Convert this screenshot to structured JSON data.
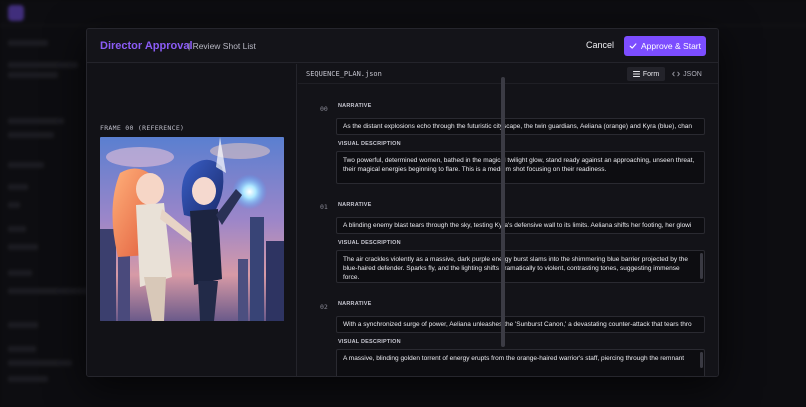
{
  "modal": {
    "title": "Director Approval",
    "subtitle": "| Review Shot List",
    "cancel_label": "Cancel",
    "approve_label": "Approve & Start",
    "approve_icon": "check-icon",
    "accent_color": "#7c4dff"
  },
  "reference": {
    "label": "FRAME 00 (REFERENCE)"
  },
  "editor": {
    "file_name": "SEQUENCE_PLAN.json",
    "view_form_label": "Form",
    "view_json_label": "JSON",
    "active_view": "Form"
  },
  "frames": [
    {
      "number": "00",
      "narrative_label": "NARRATIVE",
      "narrative": "As the distant explosions echo through the futuristic cityscape, the twin guardians, Aeliana (orange) and Kyra (blue), chan",
      "visual_label": "VISUAL DESCRIPTION",
      "visual": "Two powerful, determined women, bathed in the magical twilight glow, stand ready against an approaching, unseen threat, their magical energies beginning to flare. This is a medium shot focusing on their readiness."
    },
    {
      "number": "01",
      "narrative_label": "NARRATIVE",
      "narrative": "A blinding enemy blast tears through the sky, testing Kyra's defensive wall to its limits. Aeliana shifts her footing, her glowi",
      "visual_label": "VISUAL DESCRIPTION",
      "visual": "The air crackles violently as a massive, dark purple energy burst slams into the shimmering blue barrier projected by the blue-haired defender. Sparks fly, and the lighting shifts dramatically to violent, contrasting tones, suggesting immense force."
    },
    {
      "number": "02",
      "narrative_label": "NARRATIVE",
      "narrative": "With a synchronized surge of power, Aeliana unleashes the 'Sunburst Canon,' a devastating counter-attack that tears thro",
      "visual_label": "VISUAL DESCRIPTION",
      "visual": "A massive, blinding golden torrent of energy erupts from the orange-haired warrior's staff, piercing through the remnant"
    }
  ]
}
